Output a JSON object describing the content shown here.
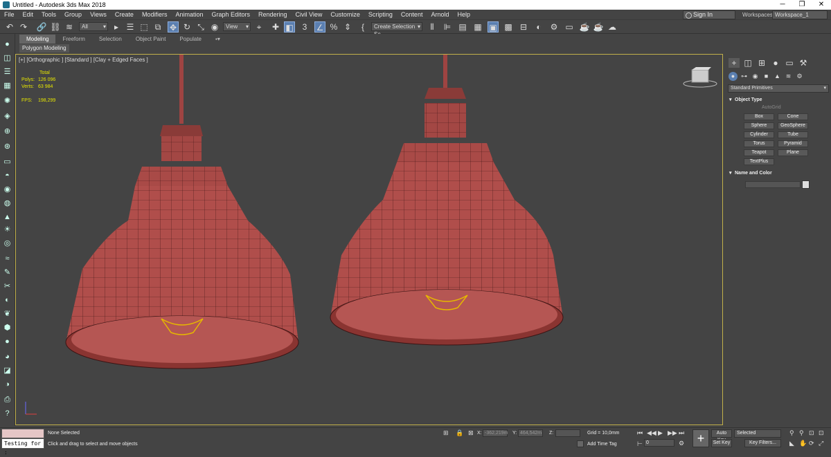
{
  "window": {
    "title": "Untitled - Autodesk 3ds Max 2018",
    "minimize": "─",
    "restore": "❐",
    "close": "✕"
  },
  "menu": [
    "File",
    "Edit",
    "Tools",
    "Group",
    "Views",
    "Create",
    "Modifiers",
    "Animation",
    "Graph Editors",
    "Rendering",
    "Civil View",
    "Customize",
    "Scripting",
    "Content",
    "Arnold",
    "Help"
  ],
  "account": {
    "sign_in": "Sign In",
    "workspaces_label": "Workspaces:",
    "workspace": "Workspace_1"
  },
  "toolbar": {
    "filter": "All",
    "ref_coord": "View",
    "selection_set": "Create Selection Se"
  },
  "ribbon": {
    "tabs": [
      "Modeling",
      "Freeform",
      "Selection",
      "Object Paint",
      "Populate"
    ],
    "active_tab": "Modeling",
    "sub": "Polygon Modeling"
  },
  "viewport": {
    "label": "[+] [Orthographic ] [Standard ] [Clay + Edged Faces ]",
    "stats": {
      "total_label": "Total",
      "polys_label": "Polys:",
      "polys": "126 096",
      "verts_label": "Verts:",
      "verts": "63 984",
      "fps_label": "FPS:",
      "fps": "198,299"
    },
    "colors": {
      "shade_fill": "#b8524f",
      "wire": "#3a1414",
      "bulb": "#e6b800",
      "border": "#c2b14a"
    }
  },
  "command_panel": {
    "category": "Standard Primitives",
    "object_type_title": "Object Type",
    "autogrid": "AutoGrid",
    "buttons": [
      "Box",
      "Cone",
      "Sphere",
      "GeoSphere",
      "Cylinder",
      "Tube",
      "Torus",
      "Pyramid",
      "Teapot",
      "Plane",
      "TextPlus"
    ],
    "name_color_title": "Name and Color"
  },
  "status": {
    "maxscript_input": "Testing for :",
    "selection": "None Selected",
    "prompt": "Click and drag to select and move objects",
    "x_label": "X:",
    "x": "-362,219m",
    "y_label": "Y:",
    "y": "464,542m",
    "z_label": "Z:",
    "z": "",
    "grid": "Grid = 10,0mm",
    "add_time_tag": "Add Time Tag",
    "auto_key": "Auto Key",
    "set_key": "Set Key",
    "selected": "Selected",
    "frame": "0",
    "key_filters": "Key Filters..."
  }
}
